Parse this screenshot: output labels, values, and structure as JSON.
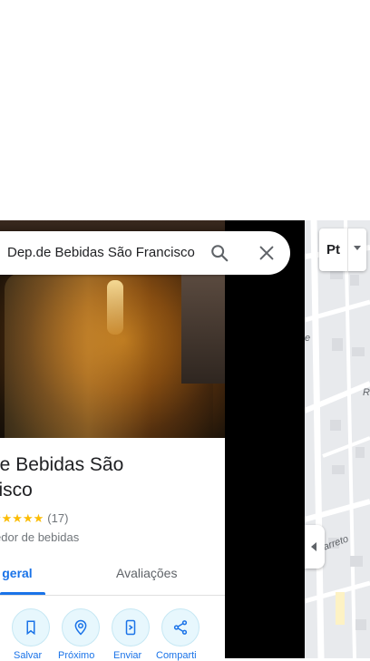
{
  "search": {
    "value": "Dep.de Bebidas São Francisco"
  },
  "place": {
    "title_line1": "de Bebidas São",
    "title_line2": "cisco",
    "stars": "★★★★★",
    "rating_count": "(17)",
    "category": "edor de bebidas"
  },
  "tabs": {
    "overview": "ão geral",
    "reviews": "Avaliações"
  },
  "actions": [
    {
      "label": "Salvar",
      "icon": "bookmark-icon"
    },
    {
      "label": "Próximo",
      "icon": "nearby-icon"
    },
    {
      "label": "Enviar",
      "icon": "send-to-phone-icon"
    },
    {
      "label": "Comparti",
      "icon": "share-icon"
    }
  ],
  "map": {
    "layer_label": "Pt",
    "street_labels": [
      "e",
      "R",
      "arreto"
    ]
  },
  "colors": {
    "accent": "#1a73e8",
    "star": "#fbbc04",
    "action_bg": "#e7f7fd"
  }
}
